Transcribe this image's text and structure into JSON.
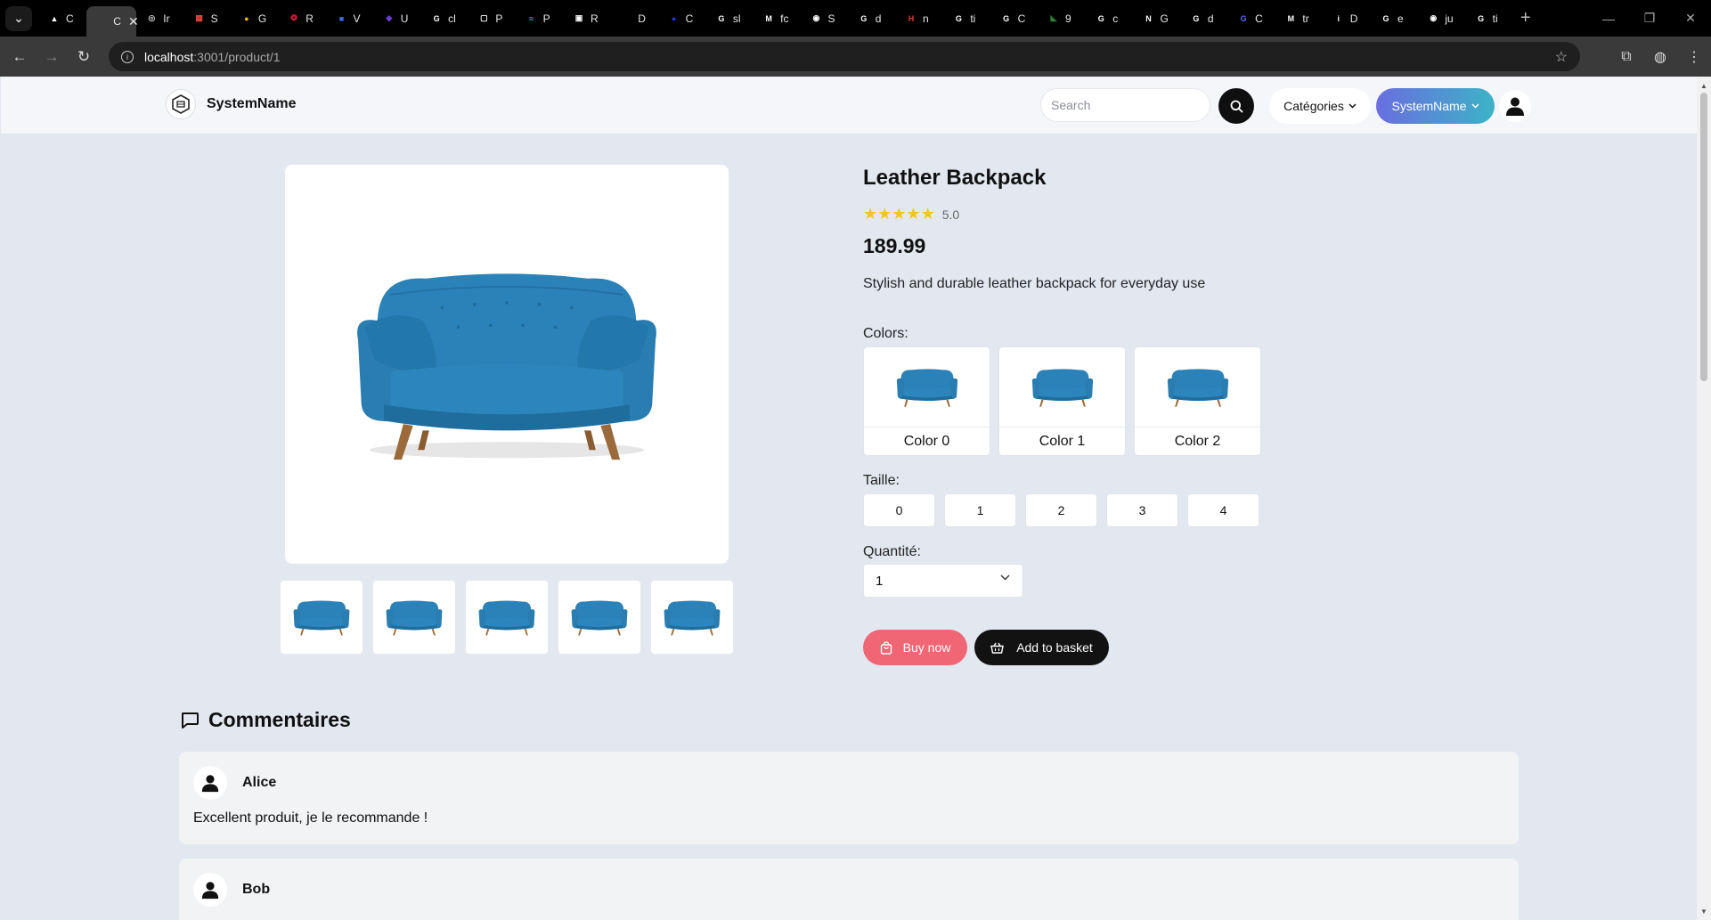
{
  "browser": {
    "tabs": [
      {
        "letter": "C",
        "color": "#ffffff",
        "glyph": "▲"
      },
      {
        "letter": "C",
        "color": "#ffffff",
        "glyph": "",
        "active": true
      },
      {
        "letter": "Ir",
        "color": "#cccccc",
        "glyph": "◎"
      },
      {
        "letter": "S",
        "color": "#e8443a",
        "glyph": "▦"
      },
      {
        "letter": "G",
        "color": "#f2b100",
        "glyph": "●"
      },
      {
        "letter": "R",
        "color": "#d02040",
        "glyph": "❂"
      },
      {
        "letter": "V",
        "color": "#3a6df0",
        "glyph": "■"
      },
      {
        "letter": "U",
        "color": "#6a3fd0",
        "glyph": "◆"
      },
      {
        "letter": "cl",
        "color": "#ffffff",
        "glyph": "G"
      },
      {
        "letter": "P",
        "color": "#ffffff",
        "glyph": "▢"
      },
      {
        "letter": "P",
        "color": "#36b3e6",
        "glyph": "≈"
      },
      {
        "letter": "R",
        "color": "#ffffff",
        "glyph": "▣"
      },
      {
        "letter": "D",
        "color": "#000000",
        "glyph": ""
      },
      {
        "letter": "C",
        "color": "#2233dd",
        "glyph": "●"
      },
      {
        "letter": "sl",
        "color": "#ffffff",
        "glyph": "G"
      },
      {
        "letter": "fc",
        "color": "#ffffff",
        "glyph": "M"
      },
      {
        "letter": "S",
        "color": "#ffffff",
        "glyph": "◉"
      },
      {
        "letter": "d",
        "color": "#ffffff",
        "glyph": "G"
      },
      {
        "letter": "n",
        "color": "#e53a2f",
        "glyph": "H"
      },
      {
        "letter": "ti",
        "color": "#ffffff",
        "glyph": "G"
      },
      {
        "letter": "C",
        "color": "#ffffff",
        "glyph": "G"
      },
      {
        "letter": "9",
        "color": "#2e7d32",
        "glyph": "◣"
      },
      {
        "letter": "c",
        "color": "#ffffff",
        "glyph": "G"
      },
      {
        "letter": "G",
        "color": "#ffffff",
        "glyph": "N"
      },
      {
        "letter": "d",
        "color": "#ffffff",
        "glyph": "G"
      },
      {
        "letter": "C",
        "color": "#5a6cf0",
        "glyph": "G"
      },
      {
        "letter": "tr",
        "color": "#ffffff",
        "glyph": "M"
      },
      {
        "letter": "D",
        "color": "#ffffff",
        "glyph": "i"
      },
      {
        "letter": "e",
        "color": "#ffffff",
        "glyph": "G"
      },
      {
        "letter": "ju",
        "color": "#ffffff",
        "glyph": "◉"
      },
      {
        "letter": "ti",
        "color": "#ffffff",
        "glyph": "G"
      }
    ],
    "url_host": "localhost",
    "url_path": ":3001/product/1"
  },
  "header": {
    "logo_name": "SystemName",
    "search_placeholder": "Search",
    "categories_label": "Catégories",
    "system_label": "SystemName"
  },
  "product": {
    "title": "Leather Backpack",
    "rating": "5.0",
    "rating_value": 5,
    "price": "189.99",
    "description": "Stylish and durable leather backpack for everyday use",
    "colors_label": "Colors:",
    "colors": [
      "Color 0",
      "Color 1",
      "Color 2"
    ],
    "size_label": "Taille:",
    "sizes": [
      "0",
      "1",
      "2",
      "3",
      "4"
    ],
    "quantity_label": "Quantité:",
    "quantity_value": "1",
    "buy_label": "Buy now",
    "basket_label": "Add to basket",
    "image_icon": "blue-sofa-image"
  },
  "comments": {
    "heading": "Commentaires",
    "items": [
      {
        "author": "Alice",
        "text": "Excellent produit, je le recommande !"
      },
      {
        "author": "Bob",
        "text": ""
      }
    ]
  },
  "colors": {
    "accent_buy": "#f06674",
    "star": "#f5c518",
    "sofa": "#2b82b8"
  }
}
